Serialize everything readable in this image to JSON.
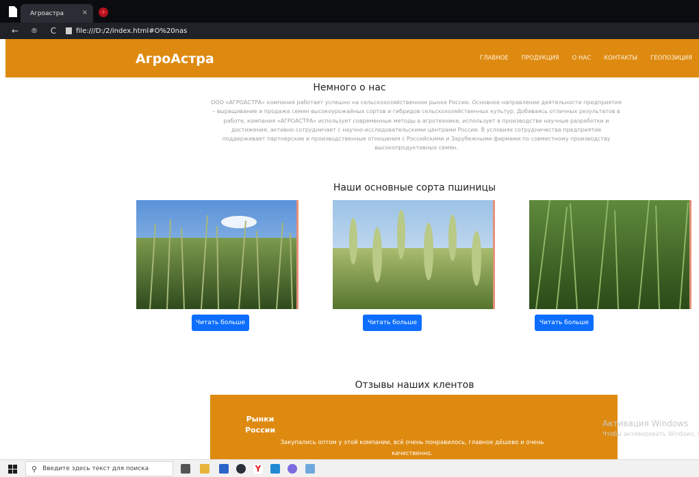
{
  "browser": {
    "tab_title": "Агроастра",
    "tab_close": "×",
    "new_tab": "+",
    "url": "file:///D:/2/index.html#О%20nas",
    "back": "←",
    "reload": "C",
    "extension": "®"
  },
  "header": {
    "brand": "АгроАстра",
    "nav": [
      "ГЛАВНОЕ",
      "ПРОДУКЦИЯ",
      "О НАС",
      "КОНТАКТЫ",
      "ГЕОПОЗИЦИЯ"
    ]
  },
  "about": {
    "title": "Немного о нас",
    "text": "ООО «АГРОАСТРА» компания работает успешно на сельскохозяйственном рынке России. Основное направление деятельности предприятия – выращивание и продажа семян высокоурожайных сортов и гибридов сельскохозяйственных культур. Добиваясь отличных результатов в работе, компания «АГРОАСТРА» использует современные методы в агротехнике, использует в производстве научные разработки и достижения, активно сотрудничает с научно-исследовательскими центрами России. В условиях сотрудничества предприятие поддерживает партнерские и производственные отношения с Российскими и Зарубежными фирмами по совместному производству высокопродуктивных семян."
  },
  "varieties": {
    "title": "Наши основные сорта пшиницы",
    "cards": [
      {
        "button": "Читать больше"
      },
      {
        "button": "Читать больше"
      },
      {
        "button": "Читать больше"
      }
    ]
  },
  "reviews": {
    "title": "Отзывы наших клентов",
    "author": "Рынки России",
    "text": "Закупались оптом у этой компании, всё очень понравилось, главное дёшево и очень качественно."
  },
  "watermark": {
    "title": "Активация Windows",
    "subtitle": "Чтобы активировать Windows, п"
  },
  "taskbar": {
    "search_placeholder": "Введите здесь текст для поиска"
  },
  "colors": {
    "accent": "#de8a10",
    "button": "#0d6efd"
  }
}
